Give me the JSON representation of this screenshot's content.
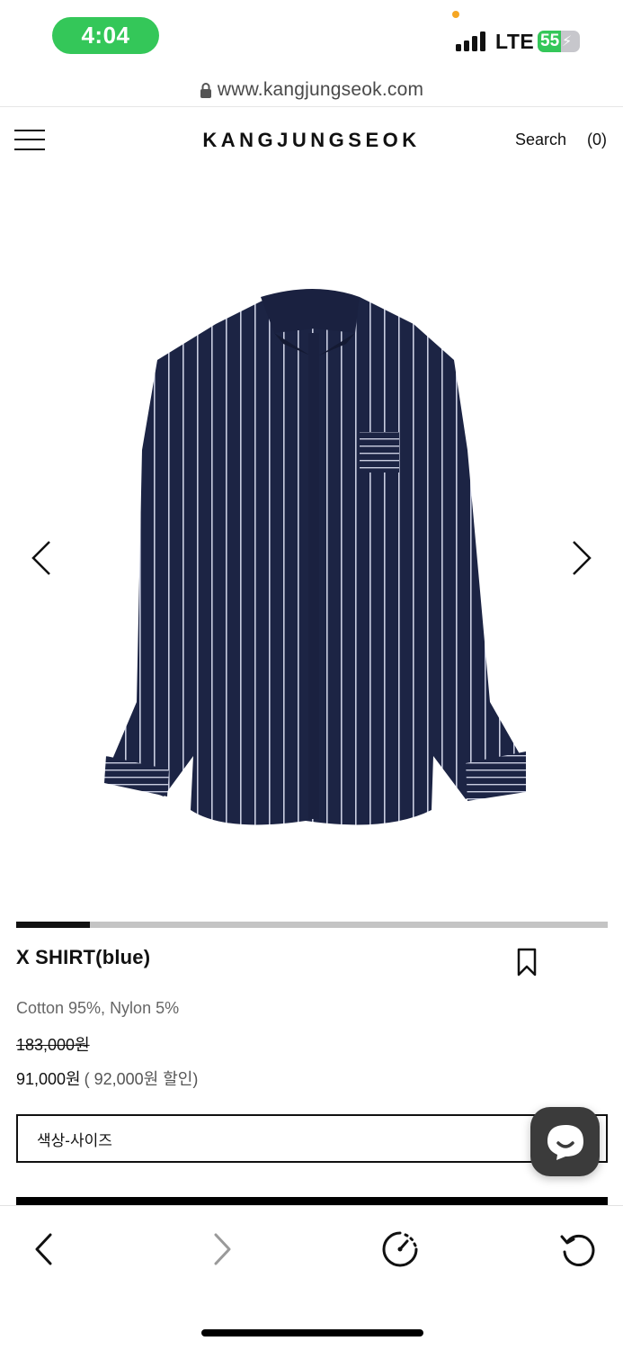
{
  "status_bar": {
    "time": "4:04",
    "network": "LTE",
    "battery_level": "55",
    "battery_percent": 55,
    "time_pill_color": "#34c759"
  },
  "browser": {
    "url": "www.kangjungseok.com"
  },
  "header": {
    "menu_icon": "hamburger-icon",
    "brand": "KANGJUNGSEOK",
    "search_label": "Search",
    "cart_label": "(0)"
  },
  "gallery": {
    "image_description_icon": "shirt-image",
    "current_slide_fraction": 0.125
  },
  "product": {
    "name": "X SHIRT(blue)",
    "material": "Cotton 95%, Nylon 5%",
    "original_price": "183,000원",
    "sale_price": "91,000원",
    "discount_text": "( 92,000원 할인)",
    "option_label": "색상-사이즈",
    "bookmark_icon": "bookmark-icon"
  },
  "toolbar": {
    "back_icon": "chevron-left-icon",
    "forward_icon": "chevron-right-icon",
    "speed_icon": "gauge-icon",
    "reload_icon": "reload-icon"
  },
  "colors": {
    "accent_green": "#34c759",
    "text": "#111111",
    "muted": "#666666"
  }
}
